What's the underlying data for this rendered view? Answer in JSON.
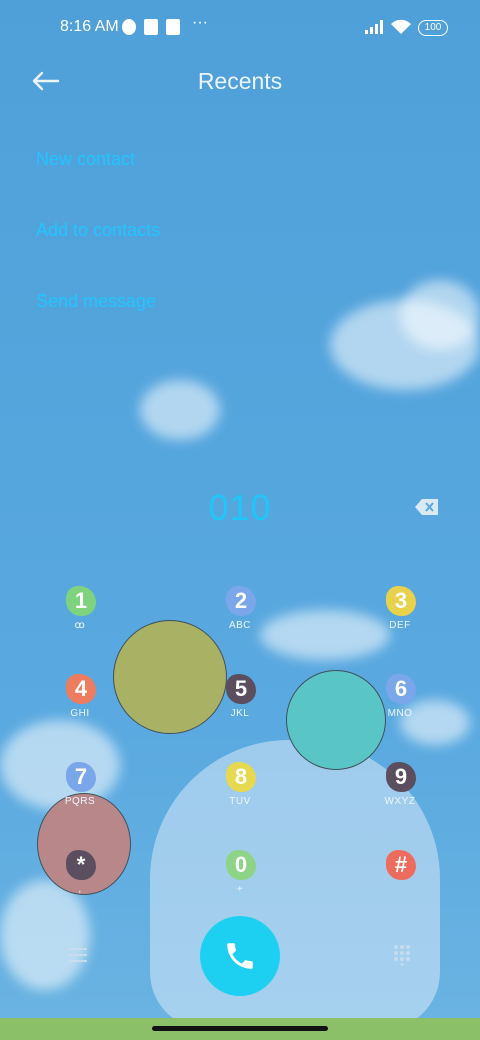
{
  "status": {
    "time": "8:16 AM",
    "battery": "100"
  },
  "header": {
    "title": "Recents"
  },
  "actions": [
    "New contact",
    "Add to contacts",
    "Send message"
  ],
  "dialer": {
    "number": "010",
    "keys": [
      {
        "digit": "1",
        "sub": "ꝏ",
        "color": "#7fd37e"
      },
      {
        "digit": "2",
        "sub": "ABC",
        "color": "#7aa7ea"
      },
      {
        "digit": "3",
        "sub": "DEF",
        "color": "#e8d24c"
      },
      {
        "digit": "4",
        "sub": "GHI",
        "color": "#ee7c5e"
      },
      {
        "digit": "5",
        "sub": "JKL",
        "color": "#5b4e5f"
      },
      {
        "digit": "6",
        "sub": "MNO",
        "color": "#7aa7ea"
      },
      {
        "digit": "7",
        "sub": "PQRS",
        "color": "#7aa7ea"
      },
      {
        "digit": "8",
        "sub": "TUV",
        "color": "#e6d950"
      },
      {
        "digit": "9",
        "sub": "WXYZ",
        "color": "#5b4e5f"
      },
      {
        "digit": "*",
        "sub": ",",
        "color": "#5b4e5f"
      },
      {
        "digit": "0",
        "sub": "+",
        "color": "#8ed486"
      },
      {
        "digit": "#",
        "sub": "",
        "color": "#ee6c5e"
      }
    ]
  },
  "colors": {
    "accent": "#21c6ff",
    "call": "#1dd0f2"
  },
  "icons": {
    "back": "arrow-left-icon",
    "delete": "backspace-icon",
    "menu": "menu-icon",
    "keypad": "dialpad-icon",
    "call": "phone-icon"
  }
}
